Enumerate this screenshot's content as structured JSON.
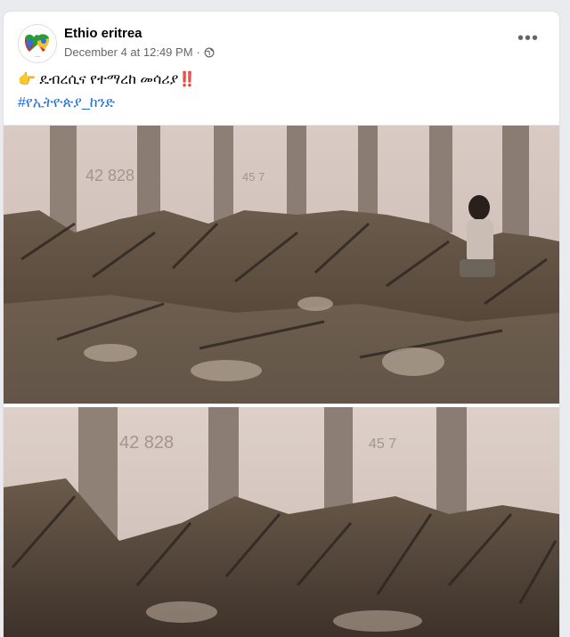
{
  "post": {
    "page_name": "Ethio eritrea",
    "timestamp": "December 4 at 12:49 PM",
    "privacy_separator": "·",
    "privacy_icon": "globe-icon",
    "more_icon": "more-options-icon",
    "pointer_emoji": "👉",
    "text": "ዴብረሲና የተማረከ መሳሪያ",
    "exclamation": "‼️",
    "hashtag": "#የኢትዮጵያ_ከንድ"
  },
  "photos": [
    {
      "description_icon": "photo-1"
    },
    {
      "description_icon": "photo-2"
    }
  ],
  "colors": {
    "link": "#216fdb",
    "meta": "#65676b",
    "name": "#050505"
  }
}
